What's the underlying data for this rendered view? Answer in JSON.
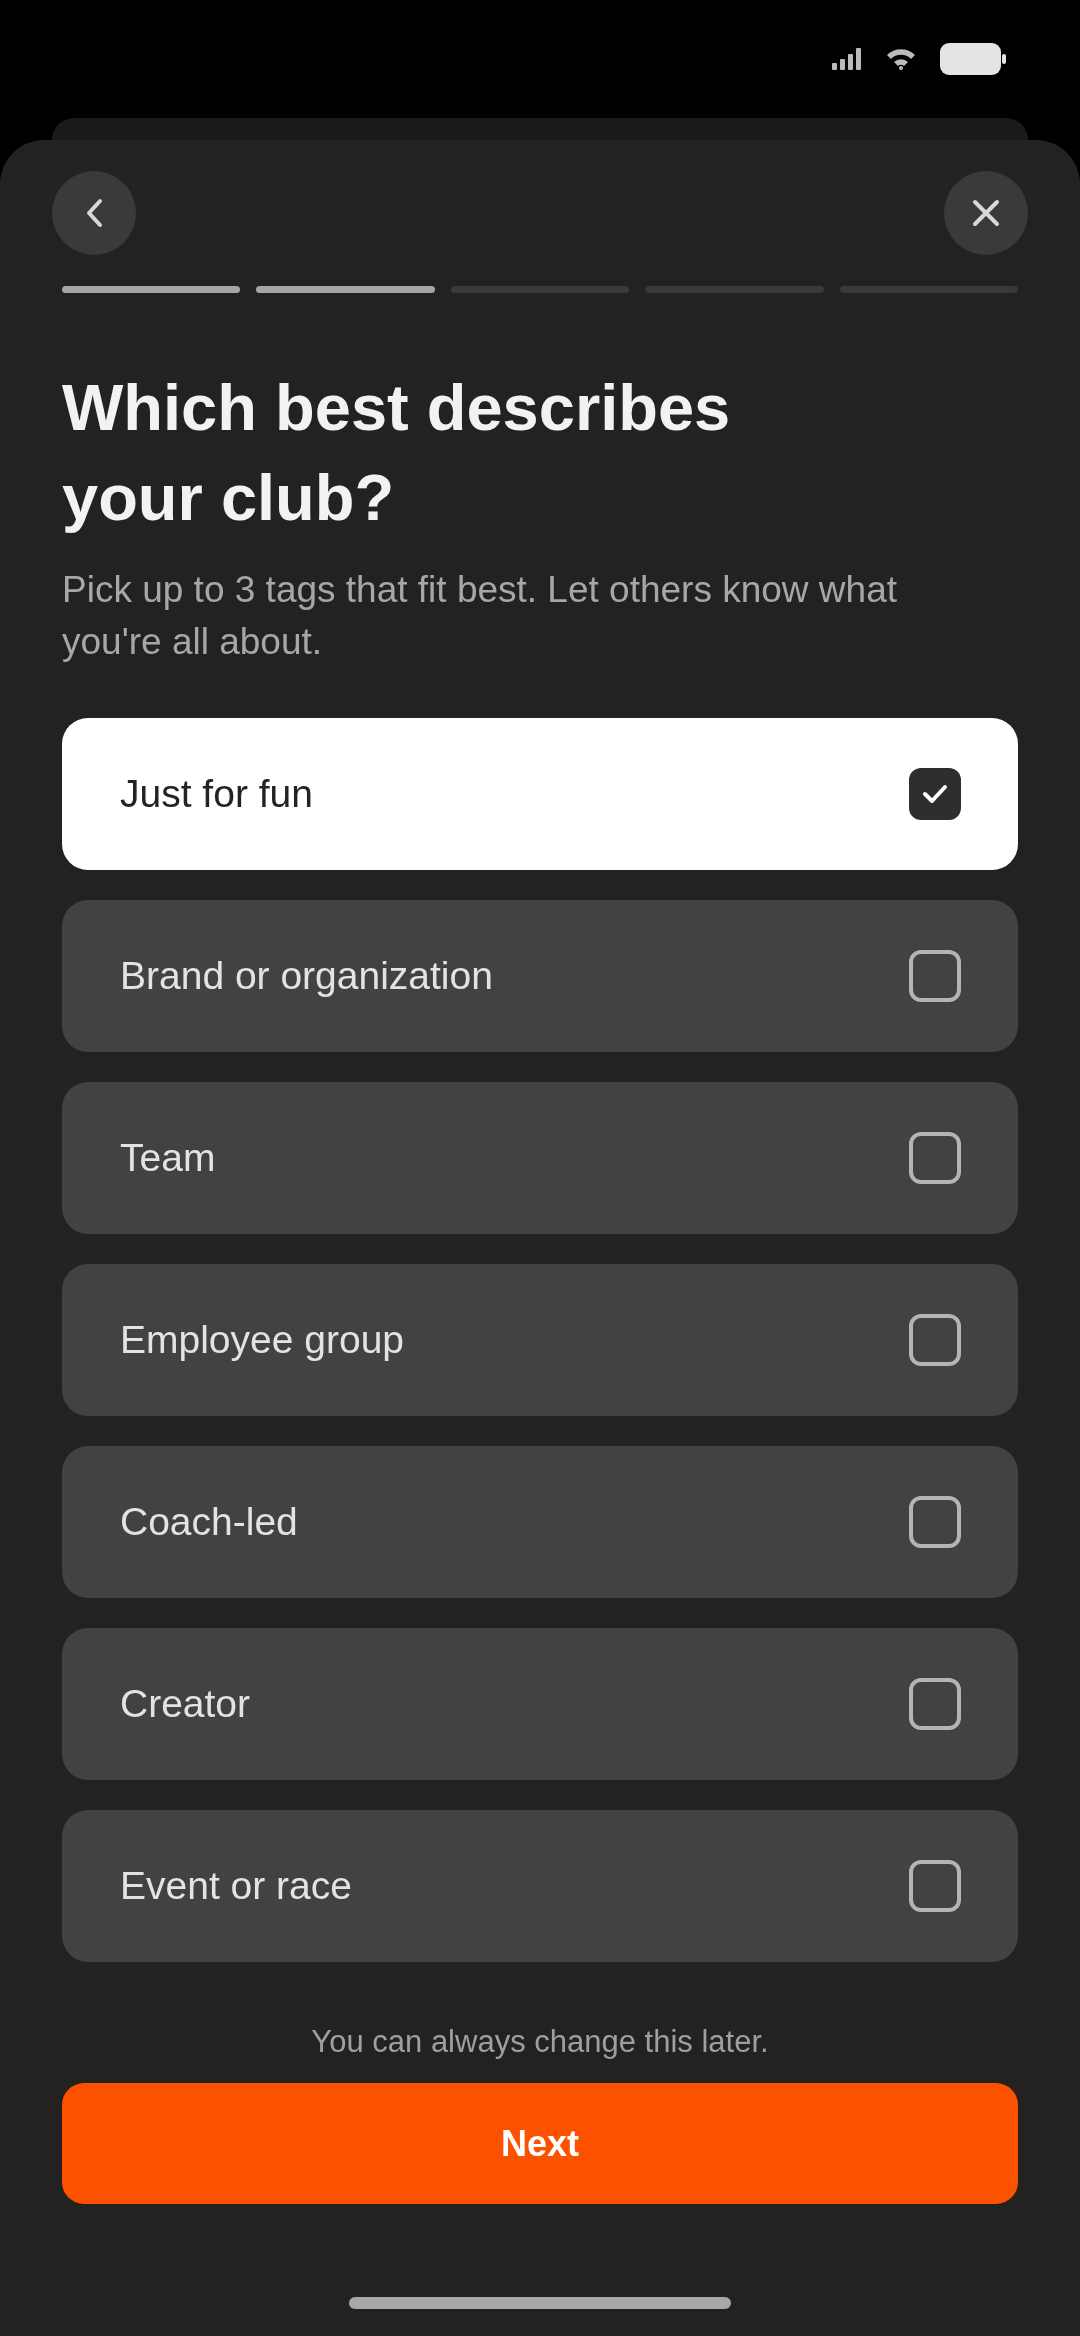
{
  "progress": {
    "steps": [
      {
        "done": true
      },
      {
        "done": true
      },
      {
        "done": false
      },
      {
        "done": false
      },
      {
        "done": false
      }
    ]
  },
  "title": "Which best describes your club?",
  "subtitle": "Pick up to 3 tags that fit best. Let others know what you're all about.",
  "options": [
    {
      "label": "Just for fun",
      "selected": true
    },
    {
      "label": "Brand or organization",
      "selected": false
    },
    {
      "label": "Team",
      "selected": false
    },
    {
      "label": "Employee group",
      "selected": false
    },
    {
      "label": "Coach-led",
      "selected": false
    },
    {
      "label": "Creator",
      "selected": false
    },
    {
      "label": "Event or race",
      "selected": false
    }
  ],
  "footer_note": "You can always change this later.",
  "next_button": {
    "label": "Next"
  }
}
